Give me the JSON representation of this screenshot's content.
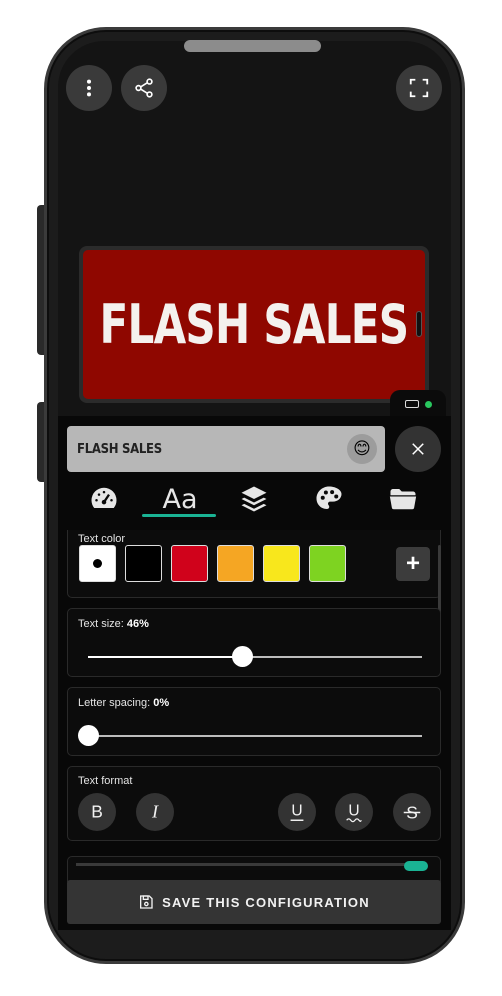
{
  "banner": {
    "text": "FLASH SALES",
    "background_color": "#8f0700",
    "text_color": "#f4f1ee"
  },
  "top_bar": {
    "menu_icon": "vertical-dots-icon",
    "share_icon": "share-icon",
    "fullscreen_icon": "fullscreen-icon"
  },
  "editor": {
    "text_value": "FLASH SALES",
    "emoji_icon": "😊",
    "close_icon": "close-icon"
  },
  "tabs": [
    {
      "name": "speed",
      "icon": "speedometer-icon"
    },
    {
      "name": "text",
      "icon": "text-aa-icon",
      "label": "Aa",
      "active": true
    },
    {
      "name": "layers",
      "icon": "layers-icon"
    },
    {
      "name": "palette",
      "icon": "palette-icon"
    },
    {
      "name": "folder",
      "icon": "folder-icon"
    }
  ],
  "text_color": {
    "label": "Text color",
    "swatches": [
      "#ffffff",
      "#000000",
      "#d0021b",
      "#f5a623",
      "#f8e71c",
      "#7ed321"
    ],
    "selected_index": 0,
    "add_label": "+"
  },
  "text_size": {
    "label": "Text size:",
    "value_text": "46%",
    "value": 0.46
  },
  "letter_spacing": {
    "label": "Letter spacing:",
    "value_text": "0%",
    "value": 0
  },
  "text_format": {
    "label": "Text format",
    "buttons": [
      {
        "name": "bold",
        "glyph": "B"
      },
      {
        "name": "italic",
        "glyph": "I"
      },
      {
        "name": "underline",
        "glyph": "U"
      },
      {
        "name": "wavy-underline",
        "glyph": "U"
      },
      {
        "name": "strikethrough",
        "glyph": "S"
      }
    ]
  },
  "save": {
    "label": "SAVE THIS CONFIGURATION",
    "icon": "floppy-disk-icon"
  },
  "colors": {
    "accent": "#1ab394",
    "panel": "#080808"
  }
}
